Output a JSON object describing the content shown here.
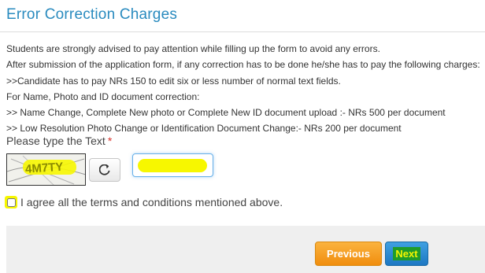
{
  "page": {
    "title": "Error Correction Charges"
  },
  "notes": [
    "Students are strongly advised to pay attention while filling up the form to avoid any errors.",
    "After submission of the application form, if any correction has to be done he/she has to pay the following charges:",
    ">>Candidate has to pay NRs 150 to edit six or less number of normal text fields.",
    "For Name, Photo and ID document correction:",
    ">> Name Change, Complete New photo or Complete New ID document upload :- NRs 500 per document",
    ">> Low Resolution Photo Change or Identification Document Change:- NRs 200 per document"
  ],
  "captcha": {
    "label": "Please type the Text",
    "required_mark": "*",
    "image_text": "4M7TY",
    "input_value": "",
    "refresh_icon": "refresh-icon"
  },
  "agree": {
    "label": "I agree all the terms and conditions mentioned above.",
    "checked": false
  },
  "buttons": {
    "previous": "Previous",
    "next": "Next"
  },
  "colors": {
    "title": "#2a8bbf",
    "highlight": "#f7f700",
    "previous": "#f39c12",
    "next": "#2a86cc",
    "required": "#d9312b"
  }
}
